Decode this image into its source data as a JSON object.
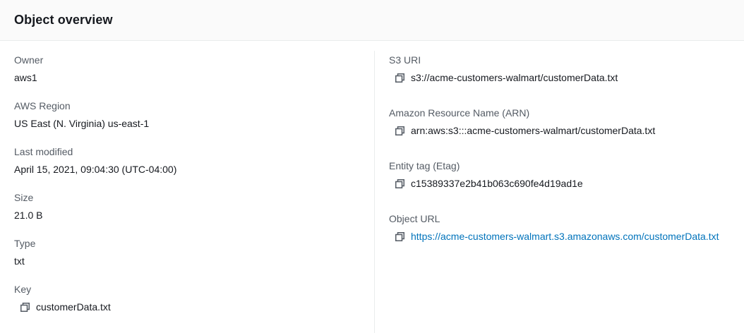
{
  "panel": {
    "title": "Object overview"
  },
  "left": {
    "owner": {
      "label": "Owner",
      "value": "aws1"
    },
    "region": {
      "label": "AWS Region",
      "value": "US East (N. Virginia) us-east-1"
    },
    "last_modified": {
      "label": "Last modified",
      "value": "April 15, 2021, 09:04:30 (UTC-04:00)"
    },
    "size": {
      "label": "Size",
      "value": "21.0 B"
    },
    "type": {
      "label": "Type",
      "value": "txt"
    },
    "key": {
      "label": "Key",
      "value": "customerData.txt",
      "icon": "copy-icon"
    }
  },
  "right": {
    "s3_uri": {
      "label": "S3 URI",
      "value": "s3://acme-customers-walmart/customerData.txt",
      "icon": "copy-icon"
    },
    "arn": {
      "label": "Amazon Resource Name (ARN)",
      "value": "arn:aws:s3:::acme-customers-walmart/customerData.txt",
      "icon": "copy-icon"
    },
    "etag": {
      "label": "Entity tag (Etag)",
      "value": "c15389337e2b41b063c690fe4d19ad1e",
      "icon": "copy-icon"
    },
    "object_url": {
      "label": "Object URL",
      "value": "https://acme-customers-walmart.s3.amazonaws.com/customerData.txt",
      "icon": "copy-icon"
    }
  },
  "colors": {
    "link": "#0073bb",
    "label": "#545b64",
    "text": "#16191f",
    "header_bg": "#fafafa",
    "divider": "#eaeded"
  }
}
